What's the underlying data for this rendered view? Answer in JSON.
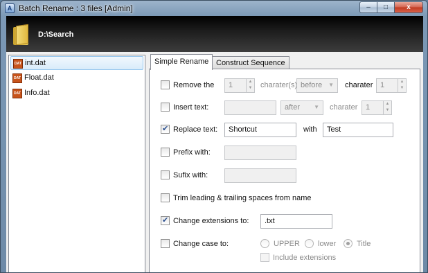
{
  "window": {
    "title": "Batch Rename : 3 files [Admin]",
    "app_icon_glyph": "A",
    "minimize_glyph": "–",
    "maximize_glyph": "□",
    "close_glyph": "x"
  },
  "header": {
    "path": "D:\\Search",
    "icon": "folder-icon"
  },
  "files": [
    {
      "name": "int.dat",
      "icon": "dat-file-icon",
      "selected": true
    },
    {
      "name": "Float.dat",
      "icon": "dat-file-icon",
      "selected": false
    },
    {
      "name": "Info.dat",
      "icon": "dat-file-icon",
      "selected": false
    }
  ],
  "file_icon_text": "DAT",
  "tabs": [
    {
      "label": "Simple Rename",
      "active": true
    },
    {
      "label": "Construct Sequence",
      "active": false
    }
  ],
  "options": {
    "remove": {
      "label": "Remove the",
      "checked": false,
      "count": "1",
      "unit_label": "charater(s)",
      "position": "before",
      "charater_label": "charater",
      "charater_value": "1"
    },
    "insert": {
      "label": "Insert text:",
      "checked": false,
      "text": "",
      "position": "after",
      "charater_label": "charater",
      "charater_value": "1"
    },
    "replace": {
      "label": "Replace text:",
      "checked": true,
      "find": "Shortcut",
      "with_label": "with",
      "replace": "Test"
    },
    "prefix": {
      "label": "Prefix with:",
      "checked": false,
      "value": ""
    },
    "sufix": {
      "label": "Sufix with:",
      "checked": false,
      "value": ""
    },
    "trim": {
      "label": "Trim leading & trailing spaces from name",
      "checked": false
    },
    "extension": {
      "label": "Change extensions to:",
      "checked": true,
      "value": ".txt"
    },
    "case": {
      "label": "Change case to:",
      "checked": false,
      "modes": [
        {
          "label": "UPPER",
          "selected": false
        },
        {
          "label": "lower",
          "selected": false
        },
        {
          "label": "Title",
          "selected": true
        }
      ],
      "include_extensions_label": "Include extensions",
      "include_extensions": false
    }
  },
  "colors": {
    "accent": "#2a4f8f",
    "disabled_text": "#8a8a8a",
    "selection_border": "#97c7ed"
  }
}
